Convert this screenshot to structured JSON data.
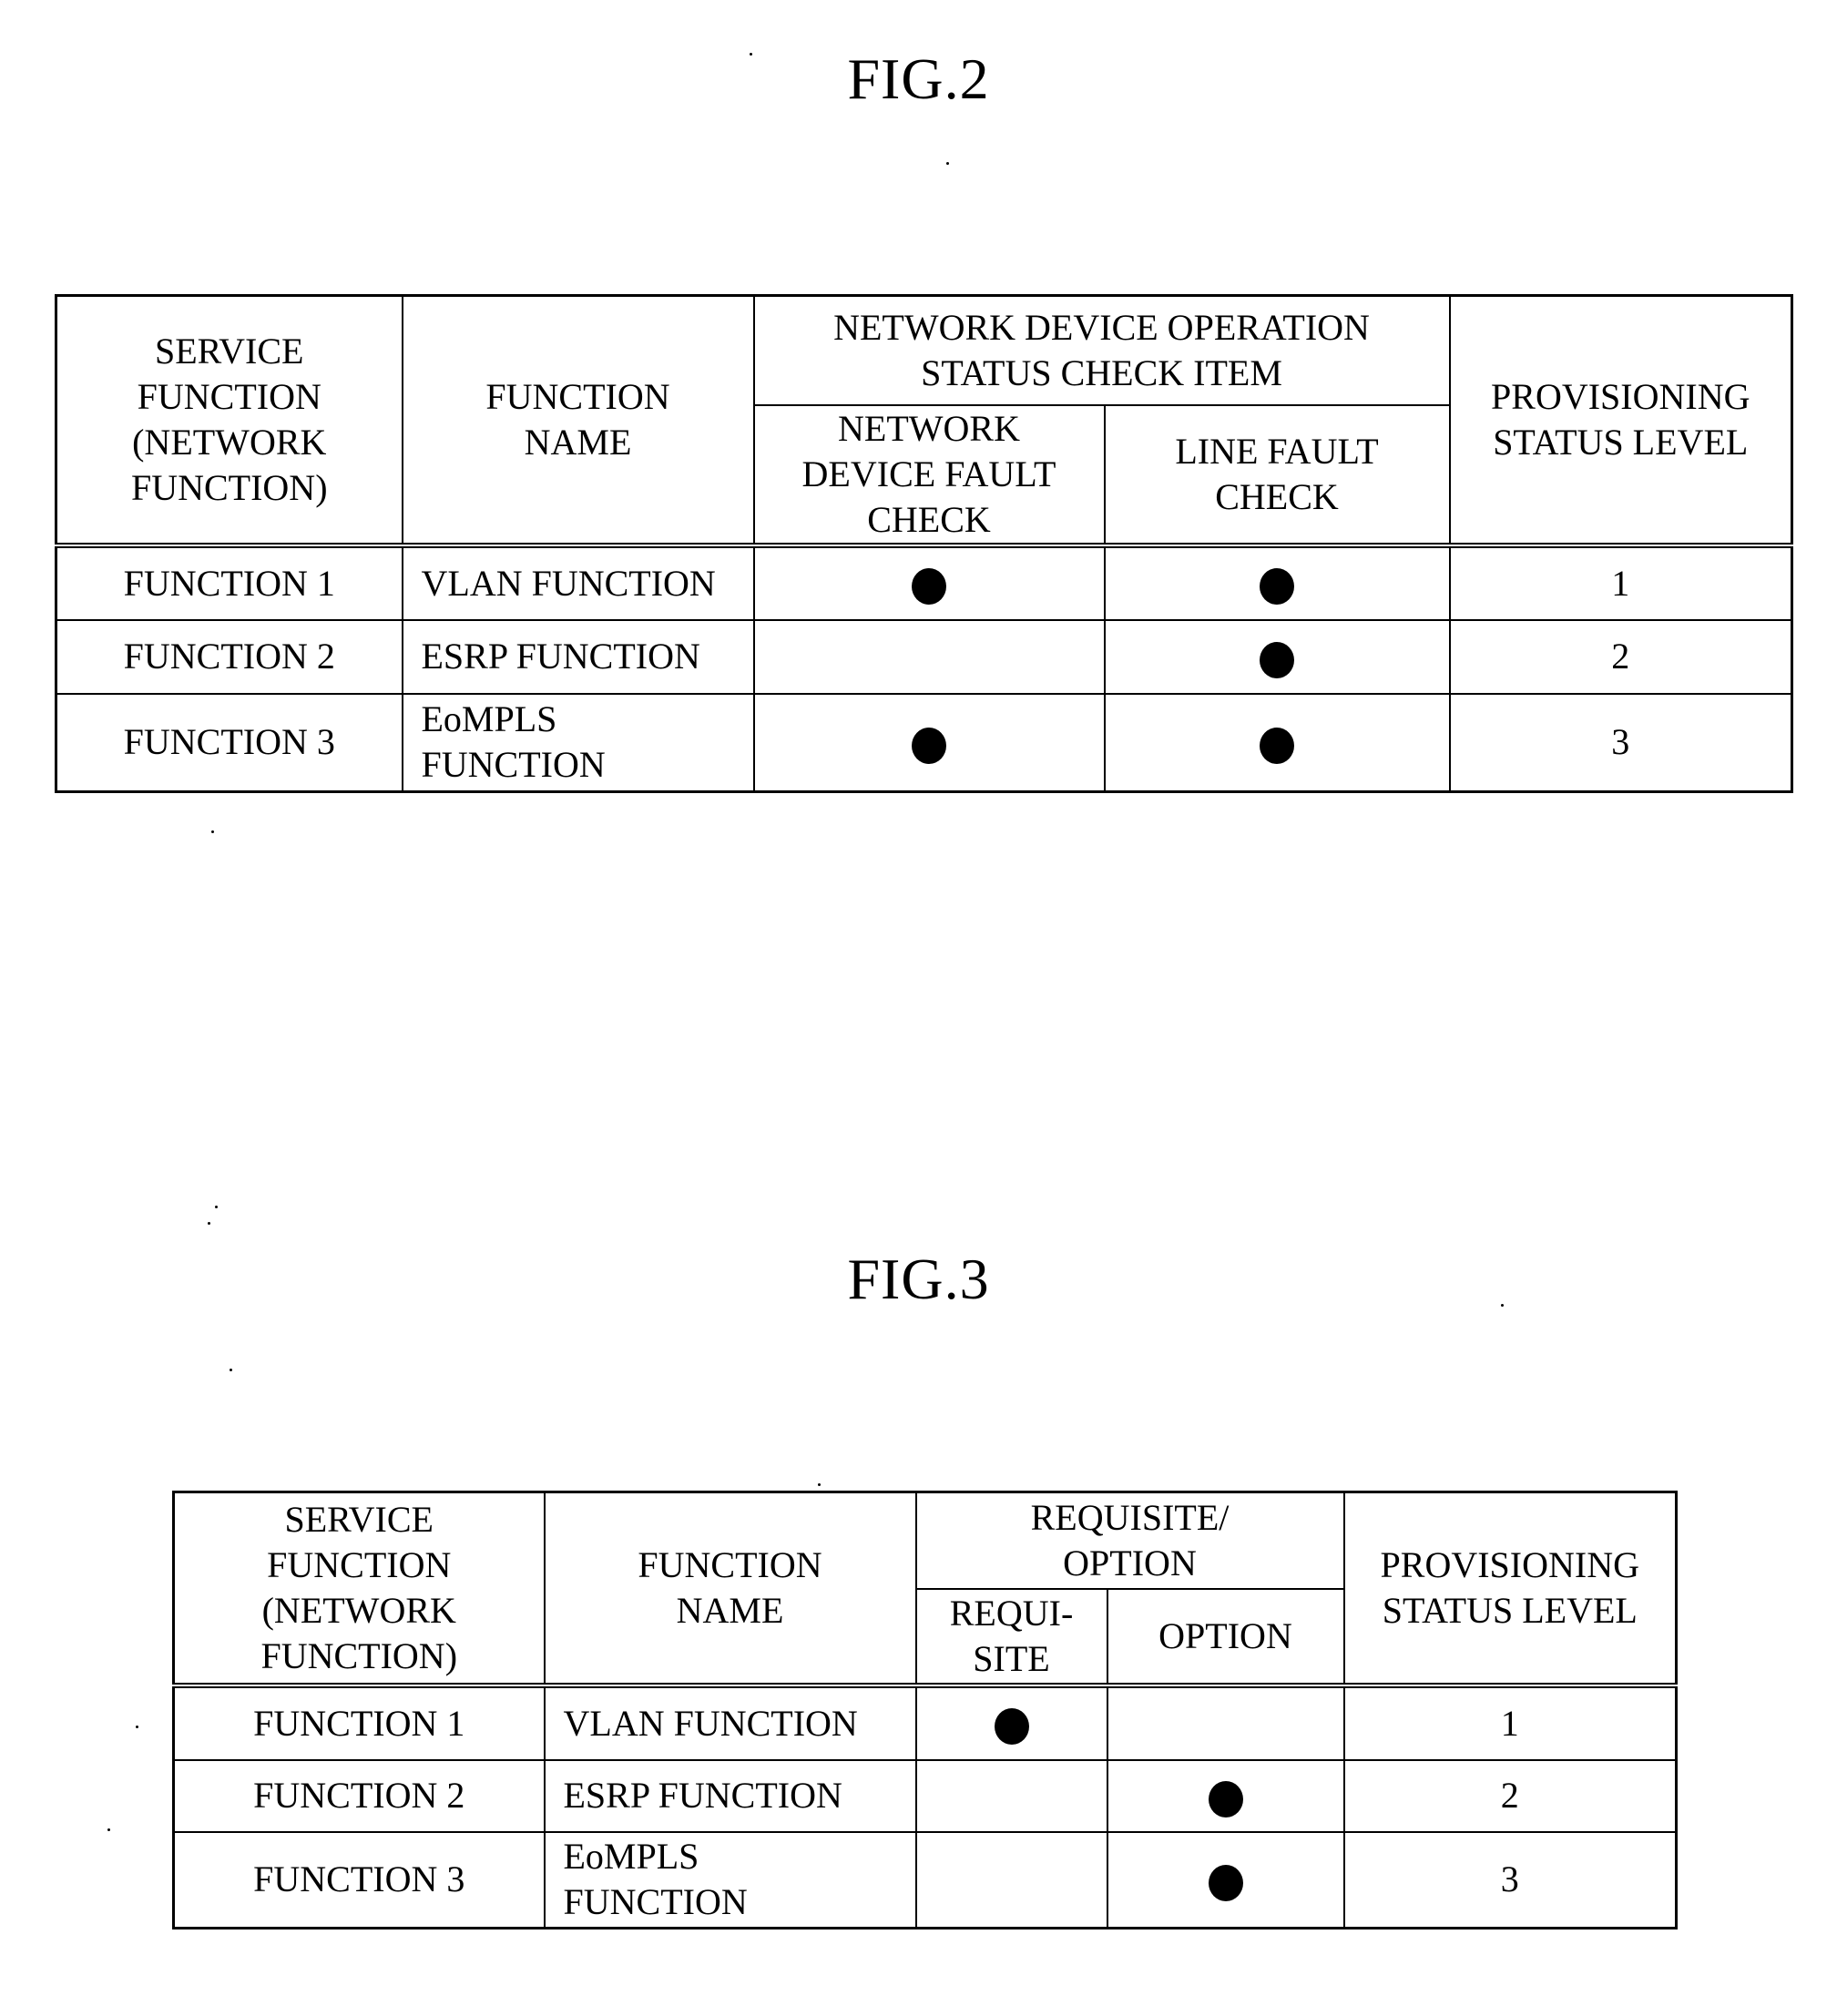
{
  "figures": [
    {
      "title": "FIG.2",
      "table": {
        "headers": {
          "service_function": "SERVICE FUNCTION (NETWORK FUNCTION)",
          "function_name": "FUNCTION NAME",
          "group": "NETWORK DEVICE OPERATION STATUS CHECK ITEM",
          "sub1": "NETWORK DEVICE FAULT CHECK",
          "sub2": "LINE FAULT CHECK",
          "level": "PROVISIONING STATUS LEVEL"
        },
        "rows": [
          {
            "service_function": "FUNCTION 1",
            "function_name": "VLAN FUNCTION",
            "sub1": true,
            "sub2": true,
            "level": "1"
          },
          {
            "service_function": "FUNCTION 2",
            "function_name": "ESRP FUNCTION",
            "sub1": false,
            "sub2": true,
            "level": "2"
          },
          {
            "service_function": "FUNCTION 3",
            "function_name": "EoMPLS FUNCTION",
            "sub1": true,
            "sub2": true,
            "level": "3"
          }
        ]
      }
    },
    {
      "title": "FIG.3",
      "table": {
        "headers": {
          "service_function": "SERVICE FUNCTION (NETWORK FUNCTION)",
          "function_name": "FUNCTION NAME",
          "group": "REQUISITE/ OPTION",
          "sub1": "REQUI- SITE",
          "sub2": "OPTION",
          "level": "PROVISIONING STATUS LEVEL"
        },
        "rows": [
          {
            "service_function": "FUNCTION 1",
            "function_name": "VLAN FUNCTION",
            "sub1": true,
            "sub2": false,
            "level": "1"
          },
          {
            "service_function": "FUNCTION 2",
            "function_name": "ESRP FUNCTION",
            "sub1": false,
            "sub2": true,
            "level": "2"
          },
          {
            "service_function": "FUNCTION 3",
            "function_name": "EoMPLS FUNCTION",
            "sub1": false,
            "sub2": true,
            "level": "3"
          }
        ]
      }
    }
  ],
  "marker_icon": "filled-circle-icon"
}
